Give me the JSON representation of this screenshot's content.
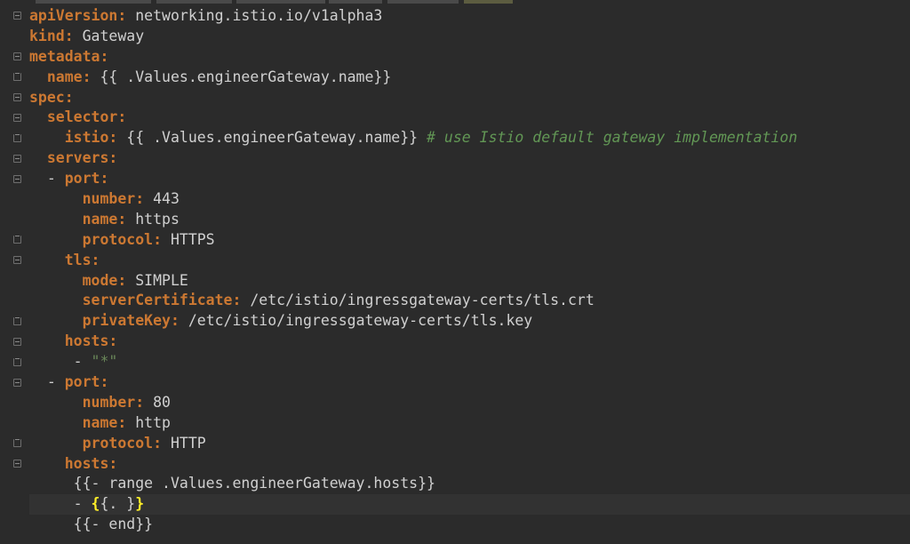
{
  "editor": {
    "lines": [
      {
        "indent": "",
        "key": "apiVersion:",
        "value": " networking.istio.io/v1alpha3"
      },
      {
        "indent": "",
        "key": "kind:",
        "value": " Gateway"
      },
      {
        "indent": "",
        "key": "metadata:",
        "value": ""
      },
      {
        "indent": "  ",
        "key": "name:",
        "value": " {{ .Values.engineerGateway.name}}"
      },
      {
        "indent": "",
        "key": "spec:",
        "value": ""
      },
      {
        "indent": "  ",
        "key": "selector:",
        "value": ""
      },
      {
        "indent": "    ",
        "key": "istio:",
        "value": " {{ .Values.engineerGateway.name}}",
        "comment": " # use Istio default gateway implementation"
      },
      {
        "indent": "  ",
        "key": "servers:",
        "value": ""
      },
      {
        "indent": "  - ",
        "key": "port:",
        "value": ""
      },
      {
        "indent": "      ",
        "key": "number:",
        "value": " 443"
      },
      {
        "indent": "      ",
        "key": "name:",
        "value": " https"
      },
      {
        "indent": "      ",
        "key": "protocol:",
        "value": " HTTPS"
      },
      {
        "indent": "    ",
        "key": "tls:",
        "value": ""
      },
      {
        "indent": "      ",
        "key": "mode:",
        "value": " SIMPLE"
      },
      {
        "indent": "      ",
        "key": "serverCertificate:",
        "value": " /etc/istio/ingressgateway-certs/tls.crt"
      },
      {
        "indent": "      ",
        "key": "privateKey:",
        "value": " /etc/istio/ingressgateway-certs/tls.key"
      },
      {
        "indent": "    ",
        "key": "hosts:",
        "value": ""
      },
      {
        "indent": "     - ",
        "key": "",
        "value": "",
        "string": "\"*\""
      },
      {
        "indent": "  - ",
        "key": "port:",
        "value": ""
      },
      {
        "indent": "      ",
        "key": "number:",
        "value": " 80"
      },
      {
        "indent": "      ",
        "key": "name:",
        "value": " http"
      },
      {
        "indent": "      ",
        "key": "protocol:",
        "value": " HTTP"
      },
      {
        "indent": "    ",
        "key": "hosts:",
        "value": ""
      },
      {
        "indent": "     ",
        "key": "",
        "value": "{{- range .Values.engineerGateway.hosts}}"
      },
      {
        "indent": "     - ",
        "key": "",
        "value": "",
        "hl_open": "{",
        "mid": "{. }",
        "hl_close": "}"
      },
      {
        "indent": "     ",
        "key": "",
        "value": "{{- end}}"
      }
    ],
    "current_line": 24
  },
  "colors": {
    "background": "#2b2b2b",
    "key": "#cc7832",
    "comment": "#629755",
    "string": "#6a8759",
    "brace_highlight": "#ffef28"
  }
}
